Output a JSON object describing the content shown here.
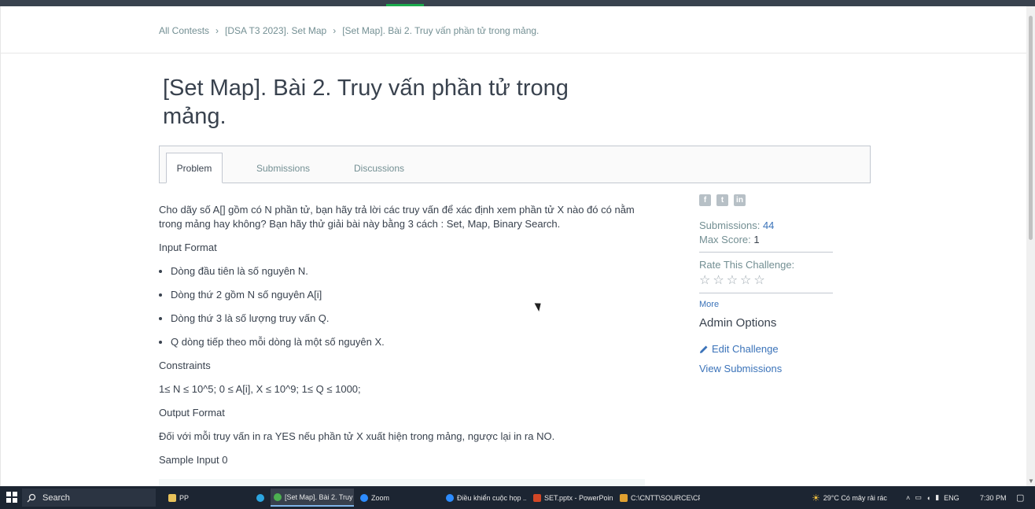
{
  "breadcrumb": [
    "All Contests",
    "[DSA T3 2023]. Set Map",
    "[Set Map]. Bài 2. Truy vấn phần tử trong mảng."
  ],
  "title": "[Set Map]. Bài 2. Truy vấn phần tử trong mảng.",
  "tabs": [
    "Problem",
    "Submissions",
    "Discussions"
  ],
  "problem": {
    "intro": "Cho dãy số A[] gồm có N phần tử, bạn hãy trả lời các truy vấn để xác định xem phần tử X nào đó có nằm trong mảng hay không? Bạn hãy thử giải bài này bằng 3 cách : Set, Map, Binary Search.",
    "input_heading": "Input Format",
    "input_items": [
      "Dòng đầu tiên là số nguyên N.",
      "Dòng thứ 2 gồm N số nguyên A[i]",
      "Dòng thứ 3 là số lượng truy vấn Q.",
      "Q dòng tiếp theo mỗi dòng là một số nguyên X."
    ],
    "constraints_heading": "Constraints",
    "constraints": "1≤ N ≤ 10^5; 0 ≤ A[i], X ≤ 10^9; 1≤ Q ≤ 1000;",
    "output_heading": "Output Format",
    "output": "Đối với mỗi truy vấn in ra YES nếu phần tử X xuất hiện trong mảng, ngược lại in ra NO.",
    "sample_heading": "Sample Input 0"
  },
  "sidebar": {
    "social": [
      "f",
      "t",
      "in"
    ],
    "submissions_label": "Submissions:",
    "submissions_value": "44",
    "max_score_label": "Max Score:",
    "max_score_value": "1",
    "rate_label": "Rate This Challenge:",
    "stars": [
      "☆",
      "☆",
      "☆",
      "☆",
      "☆"
    ],
    "more": "More",
    "admin_title": "Admin Options",
    "edit_challenge": "Edit Challenge",
    "view_submissions": "View Submissions"
  },
  "taskbar": {
    "search": "Search",
    "items": [
      "PP",
      "[Set Map]. Bài 2. Truy ...",
      "Zoom",
      "Điều khiển cuộc họp ...",
      "SET.pptx - PowerPoin...",
      "C:\\CNTT\\SOURCE\\CP..."
    ],
    "weather": "29°C  Có mây rải rác",
    "lang": "ENG",
    "time": "7:30 PM"
  },
  "colors": {
    "accent": "#1ba94c",
    "link": "#3b73b9",
    "text": "#39424e",
    "muted": "#738f93",
    "taskbar": "#1c2532"
  }
}
